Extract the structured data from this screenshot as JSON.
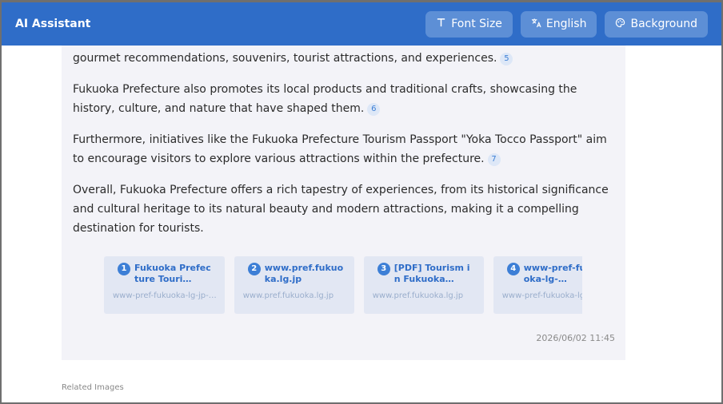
{
  "header": {
    "title": "AI Assistant",
    "font_size_label": "Font Size",
    "language_label": "English",
    "background_label": "Background"
  },
  "message": {
    "paragraphs": [
      {
        "text": "highlights local products, specialties, sake, gourmet, and lifestyle, along with information on gourmet recommendations, souvenirs, tourist attractions, and experiences.",
        "cite": "5"
      },
      {
        "text": "Fukuoka Prefecture also promotes its local products and traditional crafts, showcasing the history, culture, and nature that have shaped them.",
        "cite": "6"
      },
      {
        "text": "Furthermore, initiatives like the Fukuoka Prefecture Tourism Passport \"Yoka Tocco Passport\" aim to encourage visitors to explore various attractions within the prefecture.",
        "cite": "7"
      },
      {
        "text": "Overall, Fukuoka Prefecture offers a rich tapestry of experiences, from its historical significance and cultural heritage to its natural beauty and modern attractions, making it a compelling destination for tourists.",
        "cite": ""
      }
    ]
  },
  "sources": [
    {
      "num": "1",
      "title": "Fukuoka Prefecture Touri…",
      "domain": "www-pref-fukuoka-lg-jp-…"
    },
    {
      "num": "2",
      "title": "www.pref.fukuoka.lg.jp",
      "domain": "www.pref.fukuoka.lg.jp"
    },
    {
      "num": "3",
      "title": "[PDF] Tourism in Fukuoka…",
      "domain": "www.pref.fukuoka.lg.jp"
    },
    {
      "num": "4",
      "title": "www-pref-fukuoka-lg-…",
      "domain": "www-pref-fukuoka-lg-jp-…"
    }
  ],
  "timestamp": "2026/06/02 11:45",
  "related_label": "Related Images",
  "colors": {
    "header": "#2f6dc8",
    "header_button": "#5d8fd6",
    "card": "#f3f3f8",
    "accent": "#3d7fd6"
  },
  "icons": {
    "font_size": "text-t-icon",
    "language": "translate-icon",
    "background": "palette-icon"
  }
}
